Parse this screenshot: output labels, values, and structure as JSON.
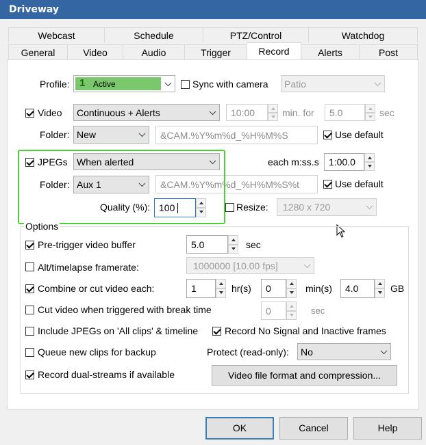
{
  "window": {
    "title": "Driveway"
  },
  "tabs_row1": [
    "Webcast",
    "Schedule",
    "PTZ/Control",
    "Watchdog"
  ],
  "tabs_row2": [
    "General",
    "Video",
    "Audio",
    "Trigger",
    "Record",
    "Alerts",
    "Post"
  ],
  "active_tab": "Record",
  "profile": {
    "label": "Profile:",
    "value": "Active",
    "color": "#7bc86c",
    "sync_label": "Sync with camera",
    "sync_checked": false,
    "camera_profile": "Patio"
  },
  "video": {
    "label": "Video",
    "checked": true,
    "mode": "Continuous + Alerts",
    "time": "10:00",
    "min_for_label": "min. for",
    "seconds": "5.0",
    "sec_label": "sec",
    "folder_label": "Folder:",
    "folder": "New",
    "filename": "&CAM.%Y%m%d_%H%M%S",
    "use_default_label": "Use default",
    "use_default_checked": true
  },
  "jpegs": {
    "label": "JPEGs",
    "checked": true,
    "mode": "When alerted",
    "each_label": "each m:ss.s",
    "interval": "1:00.0",
    "folder_label": "Folder:",
    "folder": "Aux 1",
    "filename": "&CAM.%Y%m%d_%H%M%S%t",
    "use_default_label": "Use default",
    "use_default_checked": true,
    "quality_label": "Quality (%):",
    "quality": "100",
    "resize_label": "Resize:",
    "resize_checked": false,
    "resize_value": "1280 x 720"
  },
  "options": {
    "legend": "Options",
    "pretrigger": {
      "label": "Pre-trigger video buffer",
      "checked": true,
      "value": "5.0",
      "unit": "sec"
    },
    "alt_framerate": {
      "label": "Alt/timelapse framerate:",
      "checked": false,
      "value": "1000000 [10.00 fps]"
    },
    "combine": {
      "label": "Combine or cut video each:",
      "checked": true,
      "hours": "1",
      "hours_unit": "hr(s)",
      "mins": "0",
      "mins_unit": "min(s)",
      "gb": "4.0",
      "gb_unit": "GB"
    },
    "cut_break": {
      "label": "Cut video when triggered with break time",
      "checked": false,
      "value": "0",
      "unit": "sec"
    },
    "include_jpegs": {
      "label": "Include JPEGs on 'All clips' & timeline",
      "checked": false
    },
    "no_signal": {
      "label": "Record No Signal and Inactive frames",
      "checked": true
    },
    "queue_backup": {
      "label": "Queue new clips for backup",
      "checked": false
    },
    "protect": {
      "label": "Protect (read-only):",
      "value": "No"
    },
    "dual_streams": {
      "label": "Record dual-streams if available",
      "checked": true
    },
    "format_button": "Video file format and compression..."
  },
  "buttons": {
    "ok": "OK",
    "cancel": "Cancel",
    "help": "Help"
  }
}
